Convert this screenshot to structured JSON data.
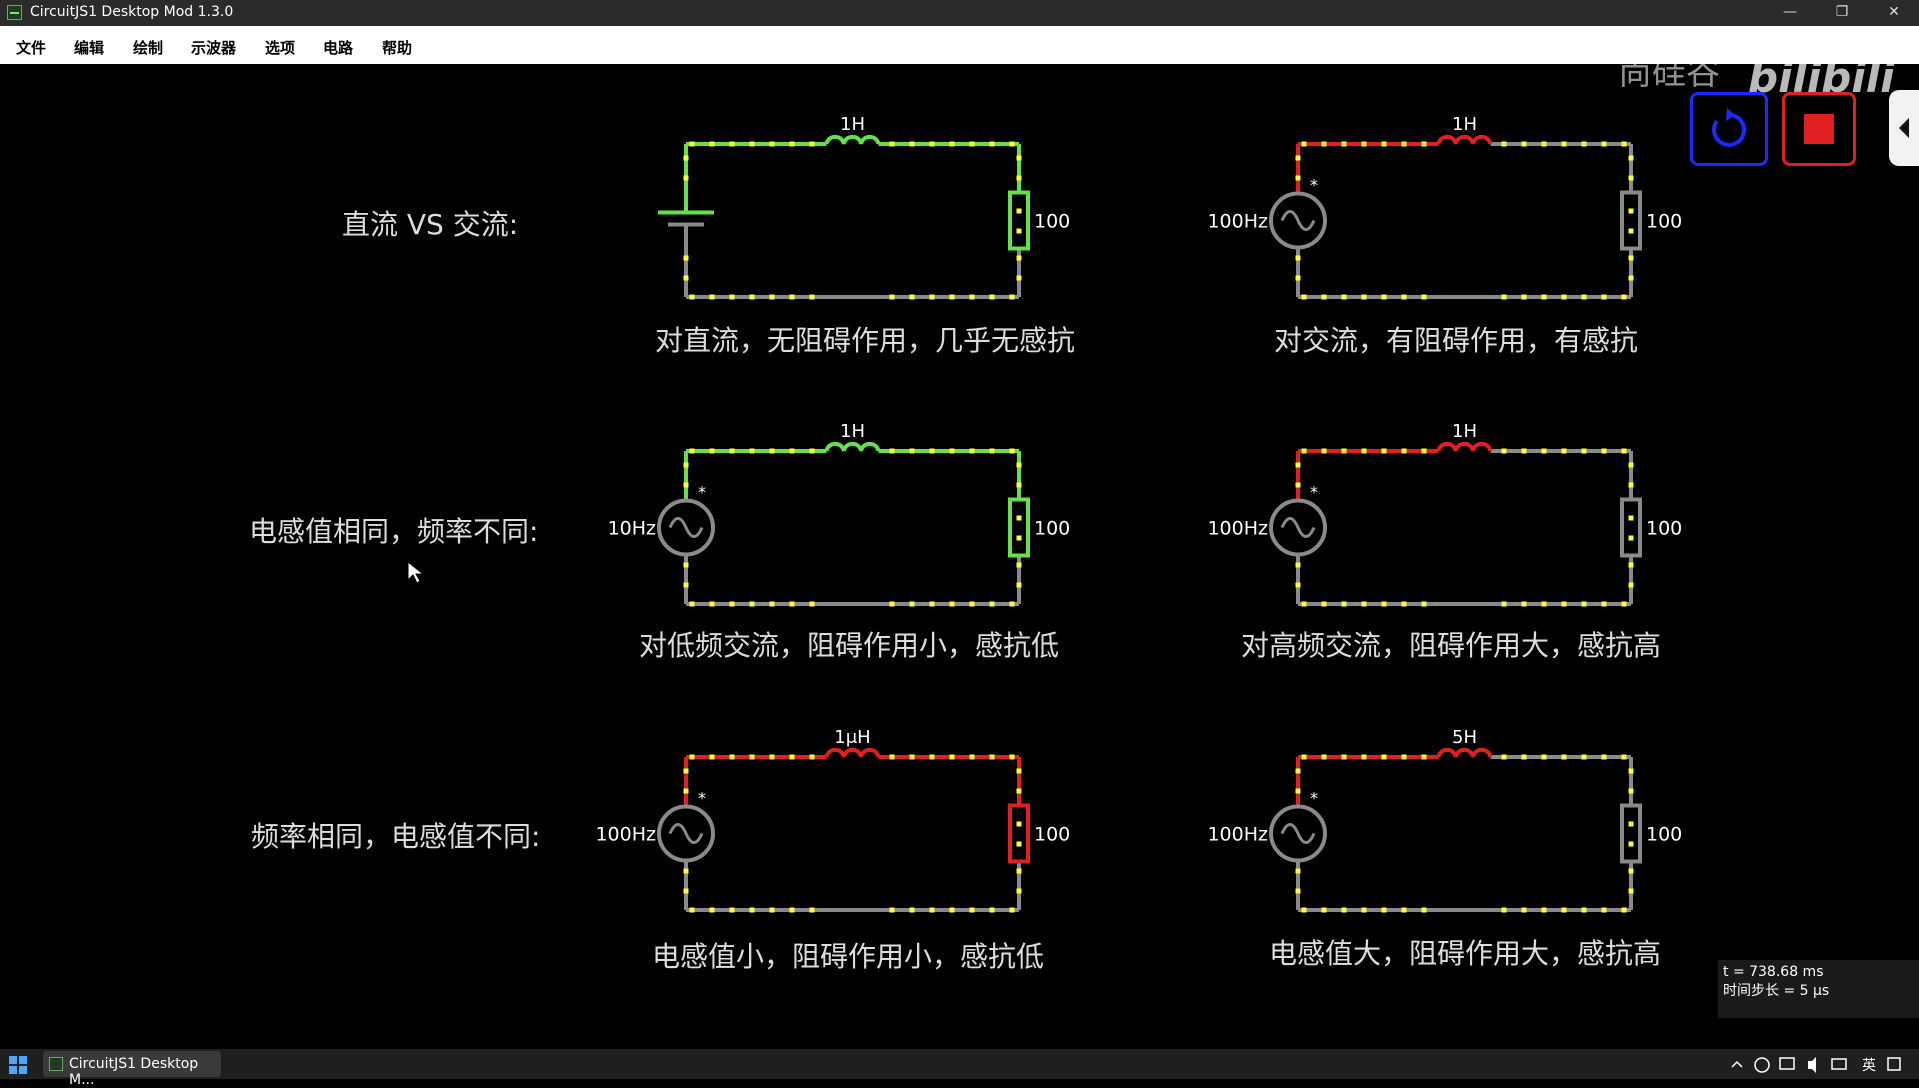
{
  "window": {
    "title": "CircuitJS1 Desktop Mod 1.3.0"
  },
  "menu": [
    {
      "label": "文件"
    },
    {
      "label": "编辑"
    },
    {
      "label": "绘制"
    },
    {
      "label": "示波器"
    },
    {
      "label": "选项"
    },
    {
      "label": "电路"
    },
    {
      "label": "帮助"
    }
  ],
  "watermark": {
    "text": "尚硅谷",
    "logo": "bilibili"
  },
  "controls": {
    "reset_icon": "reset-icon",
    "stop_icon": "stop-icon",
    "side_toggle_icon": "collapse-left-icon"
  },
  "row_labels": [
    "直流 VS 交流:",
    "电感值相同，频率不同:",
    "频率相同，电感值不同:"
  ],
  "circuits": [
    {
      "source": "battery",
      "source_label": "",
      "inductor": "1H",
      "resistor": "100",
      "caption": "对直流，无阻碍作用，几乎无感抗"
    },
    {
      "source": "ac",
      "source_label": "100Hz",
      "inductor": "1H",
      "resistor": "100",
      "caption": "对交流，有阻碍作用，有感抗"
    },
    {
      "source": "ac",
      "source_label": "10Hz",
      "inductor": "1H",
      "resistor": "100",
      "caption": "对低频交流，阻碍作用小，感抗低"
    },
    {
      "source": "ac",
      "source_label": "100Hz",
      "inductor": "1H",
      "resistor": "100",
      "caption": "对高频交流，阻碍作用大，感抗高"
    },
    {
      "source": "ac",
      "source_label": "100Hz",
      "inductor": "1μH",
      "resistor": "100",
      "caption": "电感值小，阻碍作用小，感抗低"
    },
    {
      "source": "ac",
      "source_label": "100Hz",
      "inductor": "5H",
      "resistor": "100",
      "caption": "电感值大，阻碍作用大，感抗高"
    }
  ],
  "status": {
    "time": "t = 738.68 ms",
    "timestep": "时间步长 = 5 μs"
  },
  "taskbar": {
    "app_label": "CircuitJS1 Desktop M...",
    "input_method": "英"
  },
  "colors": {
    "wire_dc": "#66e04a",
    "wire_ac": "#e02020",
    "wire_gray": "#8a8a8a",
    "current_dot": "#ffff33",
    "reset_border": "#1a2bff",
    "stop_fill": "#e02020"
  }
}
